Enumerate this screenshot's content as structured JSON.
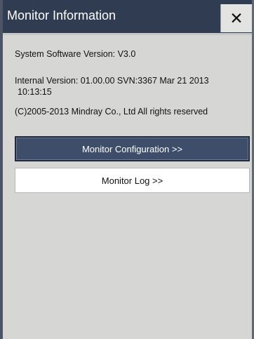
{
  "window": {
    "title": "Monitor Information",
    "close_glyph": "✕"
  },
  "info": {
    "software_version": "System Software Version:  V3.0",
    "internal_version_line1": "Internal Version:  01.00.00 SVN:3367  Mar 21 2013",
    "internal_version_line2": "10:13:15",
    "copyright": "(C)2005-2013   Mindray Co., Ltd All rights reserved"
  },
  "buttons": {
    "monitor_configuration": "Monitor Configuration >>",
    "monitor_log": "Monitor Log >>"
  },
  "colors": {
    "title_bar": "#2f3c52",
    "panel_background": "#d6d6d4",
    "selected_button": "#3e4e6a",
    "normal_button": "#ffffff"
  }
}
